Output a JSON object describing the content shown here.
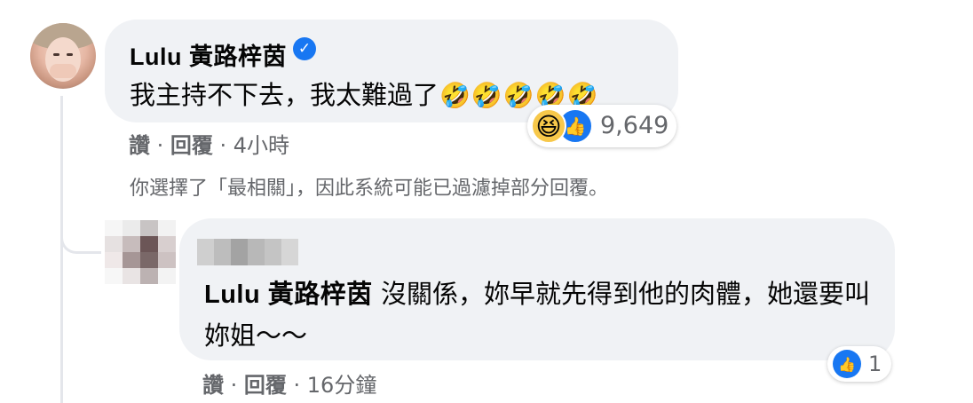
{
  "comment": {
    "author": "Lulu 黃路梓茵",
    "verified_icon": "verified-badge-icon",
    "text": "我主持不下去，我太難過了",
    "emojis": [
      "🤣",
      "🤣",
      "🤣",
      "🤣",
      "🤣"
    ],
    "reactions": {
      "icons": [
        "haha-icon",
        "like-icon"
      ],
      "count": "9,649"
    },
    "actions": {
      "like": "讚",
      "reply": "回覆",
      "time": "4小時",
      "sep": " · "
    }
  },
  "notice": "你選擇了「最相關」，因此系統可能已過濾掉部分回覆。",
  "reply": {
    "mention": "Lulu 黃路梓茵",
    "text": " 沒關係，妳早就先得到他的肉體，她還要叫妳姐～～",
    "reactions": {
      "icon": "like-icon",
      "count": "1"
    },
    "actions": {
      "like": "讚",
      "reply": "回覆",
      "time": "16分鐘",
      "sep": " · "
    }
  },
  "colors": {
    "bubble": "#f0f2f5",
    "secondary_text": "#65676b",
    "brand_blue": "#1877f2",
    "haha_yellow": "#f7c84a"
  }
}
